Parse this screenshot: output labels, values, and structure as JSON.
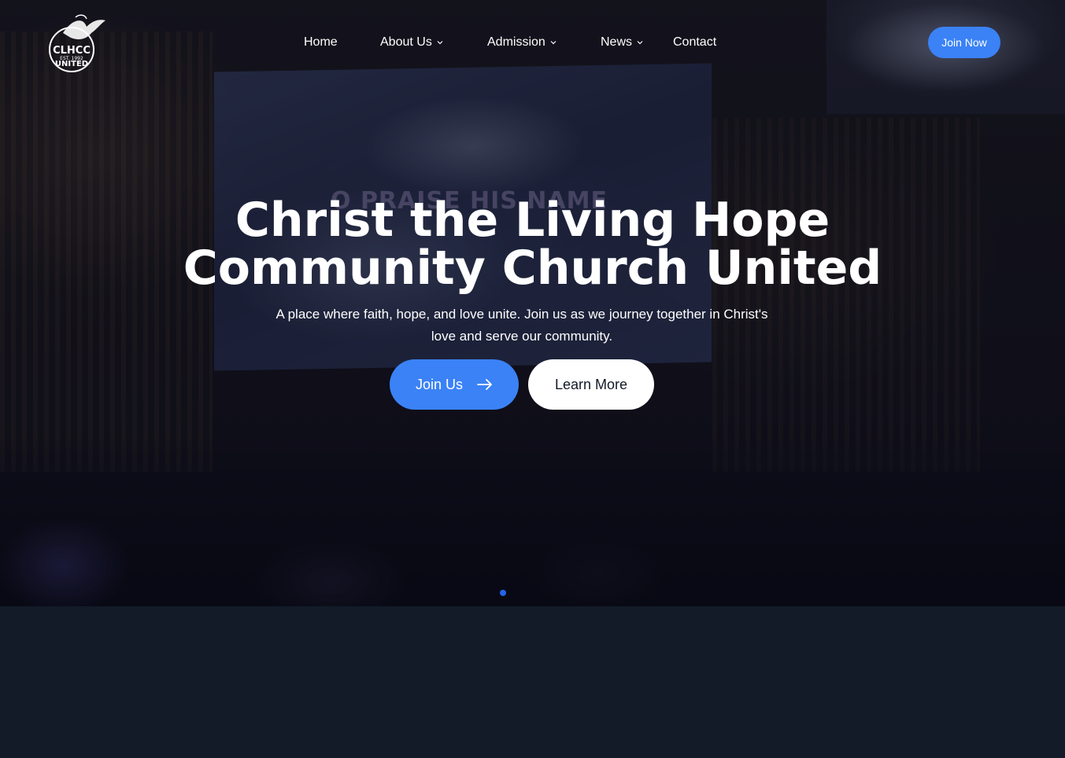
{
  "nav": {
    "logo_alt": "CLHCC UNITED EST. 1992",
    "items": [
      {
        "label": "Home",
        "has_dropdown": false
      },
      {
        "label": "About Us",
        "has_dropdown": true
      },
      {
        "label": "Admission",
        "has_dropdown": true
      },
      {
        "label": "News",
        "has_dropdown": true
      },
      {
        "label": "Contact",
        "has_dropdown": false
      }
    ],
    "cta_label": "Join Now"
  },
  "hero": {
    "title_line1": "Christ the Living Hope",
    "title_line2": "Community Church United",
    "subtitle": "A place where faith, hope, and love unite. Join us as we journey together in Christ's love and serve our community.",
    "primary_button": "Join Us",
    "secondary_button": "Learn More",
    "background_screen_text": "O PRAISE HIS NAME",
    "slides_count": 1,
    "active_slide": 1
  },
  "colors": {
    "accent": "#3b82f6",
    "page_background": "#131a28",
    "text": "#ffffff"
  },
  "icons": {
    "logo": "dove-logo-icon",
    "chevron": "chevron-down-icon",
    "arrow": "arrow-right-icon"
  }
}
